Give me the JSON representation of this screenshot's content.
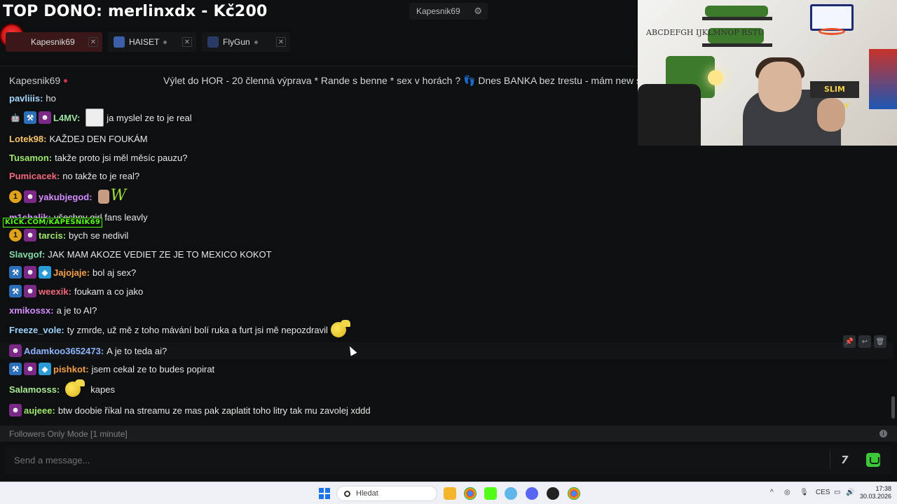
{
  "overlay": {
    "top_dono": "TOP DONO: merlinxdx - Kč200",
    "center_channel": "Kapesnik69",
    "kick_url": "KICK.COM/KAPESNIK69"
  },
  "tabs": [
    {
      "label": "Kapesnik69",
      "color": "#d42b2b"
    },
    {
      "label": "HAISET",
      "color": "#3d5ea8"
    },
    {
      "label": "FlyGun",
      "color": "#2a3a66"
    }
  ],
  "channel_bar": {
    "name": "Kapesnik69",
    "title": "Výlet do HOR - 20 členná výprava * Rande s benne * sex v horách ? 👣 Dnes BANKA bez trestu - mám new strategii"
  },
  "webcam": {
    "sign_text": "SLIM SHADY",
    "wall_text": "ABCDEFGH IJKLMNOP RSTU"
  },
  "colors": {
    "accent_green": "#53fc18",
    "live_red": "#d0334a"
  },
  "messages": [
    {
      "user": "pavliiis:",
      "color": "#a5d8ff",
      "text": "ho"
    },
    {
      "user": "L4MV:",
      "color": "#9be2a3",
      "text": "ja myslel ze to je real"
    },
    {
      "user": "Lotek98:",
      "color": "#f7c26b",
      "text": "KAŽDEJ DEN FOUKÁM"
    },
    {
      "user": "Tusamon:",
      "color": "#9fe86d",
      "text": "takže proto jsi měl měsíc pauzu?"
    },
    {
      "user": "Pumicacek:",
      "color": "#f2697d",
      "text": "no takže to je real?"
    },
    {
      "user": "yakubjegod:",
      "color": "#d58cff",
      "text": ""
    },
    {
      "user": "m1chalik:",
      "color": "#d58cff",
      "text": "všechny girl fans leavly"
    },
    {
      "user": "tarcis:",
      "color": "#9fe86d",
      "text": "bych se nedivil"
    },
    {
      "user": "Slavgof:",
      "color": "#86d9a8",
      "text": "JAK MAM AKOZE VEDIET ZE JE TO MEXICO KOKOT"
    },
    {
      "user": "Jajojaje:",
      "color": "#f5a04a",
      "text": "bol aj sex?"
    },
    {
      "user": "weexik:",
      "color": "#f2697d",
      "text": "foukam a co jako"
    },
    {
      "user": "xmikossx:",
      "color": "#d58cff",
      "text": "a je to AI?"
    },
    {
      "user": "Freeze_vole:",
      "color": "#9bd2ff",
      "text": "ty zmrde, už mě z toho mávání bolí ruka a furt jsi mě nepozdravil"
    },
    {
      "user": "Adamkoo3652473:",
      "color": "#8fb4ff",
      "text": "A je to teda ai?"
    },
    {
      "user": "pishkot:",
      "color": "#f5a04a",
      "text": "jsem cekal ze to budes popirat"
    },
    {
      "user": "Salamosss:",
      "color": "#a7e892",
      "text": "kapes"
    },
    {
      "user": "aujeee:",
      "color": "#9fe86d",
      "text": "btw doobie říkal na streamu ze mas pak zaplatit toho litry tak mu zavolej xddd"
    }
  ],
  "badges": {
    "num": "1"
  },
  "input": {
    "followers_mode": "Followers Only Mode [1 minute]",
    "placeholder": "Send a message...",
    "seven_tv": "7"
  },
  "taskbar": {
    "search_placeholder": "Hledat",
    "lang": "CES",
    "time": "17:38",
    "date": "30.03.2026"
  }
}
